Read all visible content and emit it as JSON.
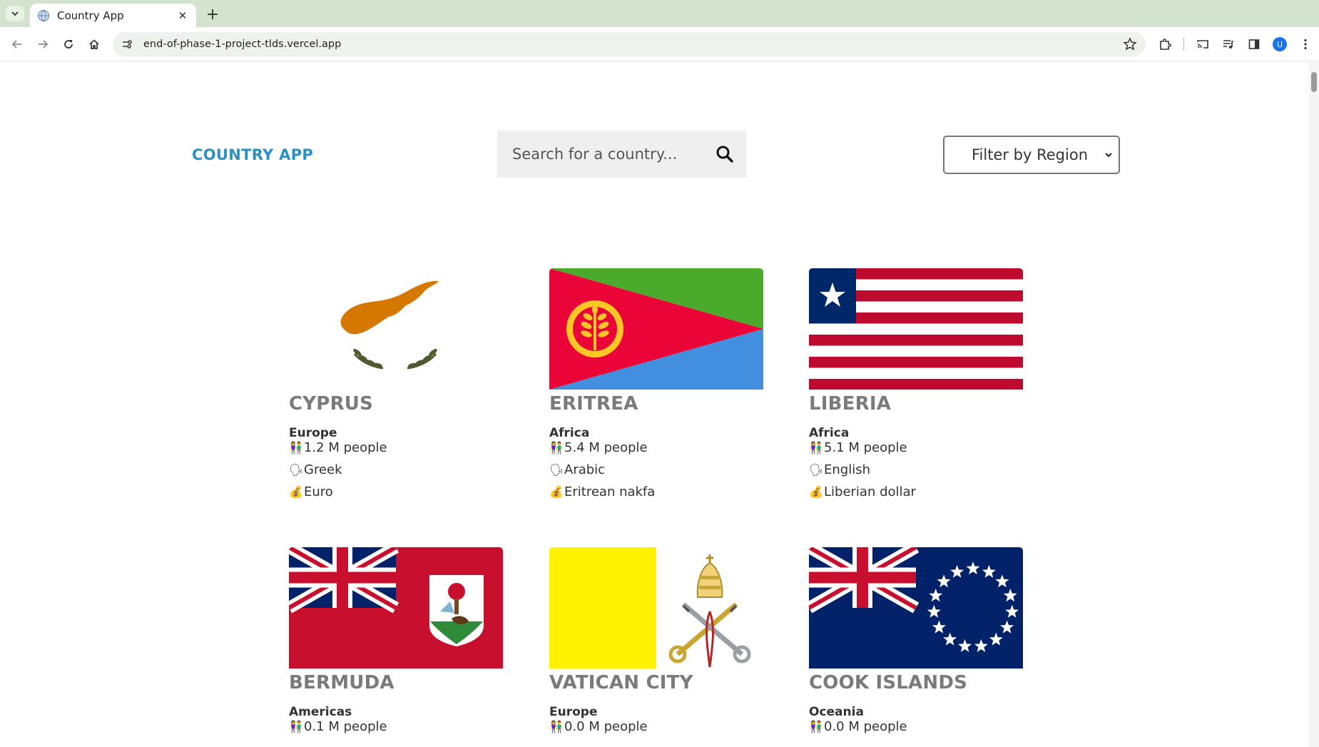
{
  "browser": {
    "tab_title": "Country App",
    "url": "end-of-phase-1-project-tlds.vercel.app",
    "avatar_initial": "U"
  },
  "header": {
    "brand": "COUNTRY APP",
    "search_placeholder": "Search for a country...",
    "filter_label": "Filter by Region"
  },
  "countries": [
    {
      "name": "CYPRUS",
      "region": "Europe",
      "population": "1.2 M people",
      "language": "Greek",
      "currency": "Euro"
    },
    {
      "name": "ERITREA",
      "region": "Africa",
      "population": "5.4 M people",
      "language": "Arabic",
      "currency": "Eritrean nakfa"
    },
    {
      "name": "LIBERIA",
      "region": "Africa",
      "population": "5.1 M people",
      "language": "English",
      "currency": "Liberian dollar"
    },
    {
      "name": "BERMUDA",
      "region": "Americas",
      "population": "0.1 M people",
      "language": "",
      "currency": ""
    },
    {
      "name": "VATICAN CITY",
      "region": "Europe",
      "population": "0.0 M people",
      "language": "",
      "currency": ""
    },
    {
      "name": "COOK ISLANDS",
      "region": "Oceania",
      "population": "0.0 M people",
      "language": "",
      "currency": ""
    }
  ],
  "emoji": {
    "people": "👫",
    "speech": "🗣",
    "money": "💰"
  },
  "colors": {
    "brand": "#2a91c1",
    "tabbar": "#d3e3cd"
  }
}
